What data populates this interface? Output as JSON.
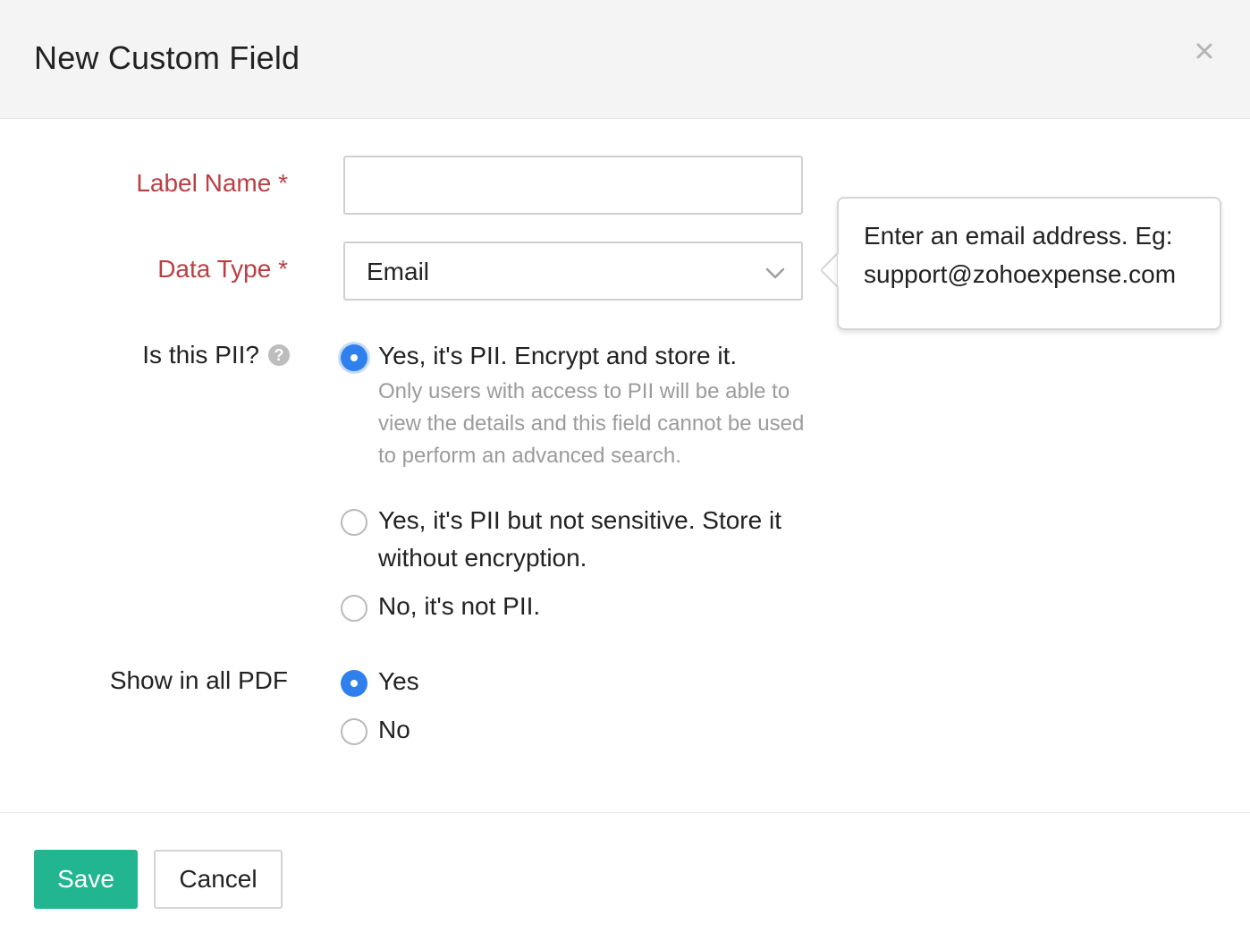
{
  "dialog": {
    "title": "New Custom Field",
    "close_icon": "close-icon"
  },
  "form": {
    "label_name": {
      "label": "Label Name *",
      "value": "",
      "placeholder": ""
    },
    "data_type": {
      "label": "Data Type *",
      "selected": "Email",
      "icon": "chevron-down-icon"
    },
    "pii": {
      "label": "Is this PII?",
      "help_icon": "question-circle-icon",
      "options": [
        {
          "label": "Yes, it's PII. Encrypt and store it.",
          "checked": true,
          "help": "Only users with access to PII will be able to view the details and this field cannot be used to perform an advanced search."
        },
        {
          "label_line1": "Yes, it's PII but not sensitive. Store it",
          "label_line2": "without encryption.",
          "checked": false
        },
        {
          "label": "No, it's not PII.",
          "checked": false
        }
      ]
    },
    "show_in_pdf": {
      "label": "Show in all PDF",
      "options": [
        {
          "label": "Yes",
          "checked": true
        },
        {
          "label": "No",
          "checked": false
        }
      ]
    }
  },
  "tooltip": {
    "line1": "Enter an email address. Eg:",
    "line2": "support@zohoexpense.com"
  },
  "footer": {
    "save_label": "Save",
    "cancel_label": "Cancel"
  },
  "colors": {
    "required_label": "#b94045",
    "radio_checked": "#2f80ed",
    "save_button": "#21b68f",
    "header_bg": "#f4f4f4"
  }
}
